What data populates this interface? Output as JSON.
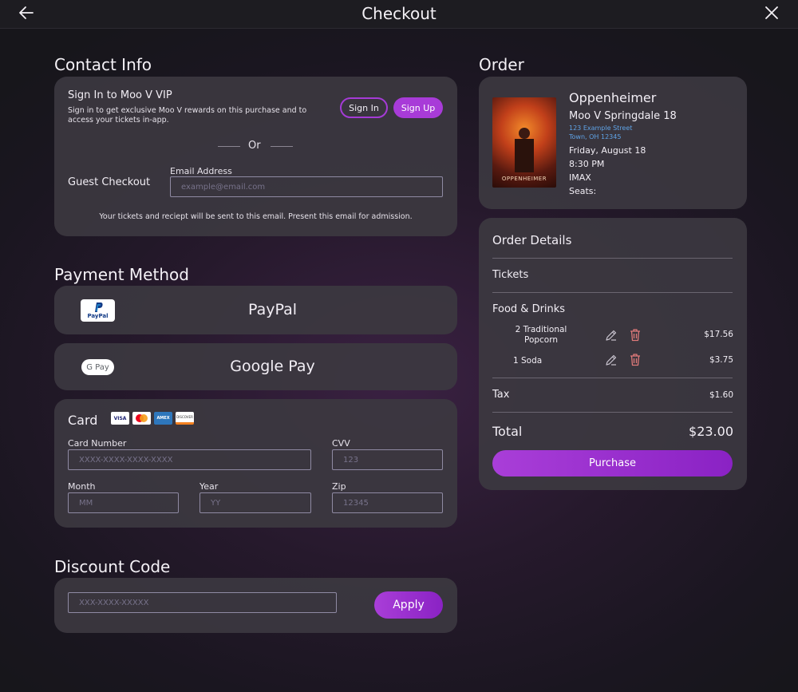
{
  "header": {
    "title": "Checkout"
  },
  "contact": {
    "section_title": "Contact Info",
    "vip_title": "Sign In to Moo V VIP",
    "vip_desc": "Sign in to get exclusive Moo V rewards on this purchase and to access your tickets in-app.",
    "signin_label": "Sign In",
    "signup_label": "Sign Up",
    "or_label": "Or",
    "guest_label": "Guest Checkout",
    "email_label": "Email Address",
    "email_placeholder": "example@email.com",
    "note": "Your tickets and reciept will be sent to this email. Present this email for admission."
  },
  "payment": {
    "section_title": "Payment Method",
    "paypal_label": "PayPal",
    "paypal_logo_text": "PayPal",
    "gpay_label": "Google Pay",
    "gpay_logo_text": "G Pay",
    "card_title": "Card",
    "card_brands": [
      "VISA",
      "MC",
      "AMEX",
      "DISCOVER"
    ],
    "card_number_label": "Card Number",
    "card_number_placeholder": "XXXX-XXXX-XXXX-XXXX",
    "cvv_label": "CVV",
    "cvv_placeholder": "123",
    "month_label": "Month",
    "month_placeholder": "MM",
    "year_label": "Year",
    "year_placeholder": "YY",
    "zip_label": "Zip",
    "zip_placeholder": "12345"
  },
  "discount": {
    "section_title": "Discount Code",
    "placeholder": "XXX-XXXX-XXXXX",
    "apply_label": "Apply"
  },
  "order": {
    "section_title": "Order",
    "movie_title": "Oppenheimer",
    "poster_text": "OPPENHEIMER",
    "theater": "Moo V Springdale 18",
    "address_line1": "123 Example Street",
    "address_line2": "Town, OH 12345",
    "date": "Friday, August 18",
    "time": "8:30 PM",
    "format": "IMAX",
    "seats_label": "Seats:"
  },
  "order_details": {
    "title": "Order Details",
    "tickets_label": "Tickets",
    "food_label": "Food & Drinks",
    "items": [
      {
        "name_line1": "2 Traditional",
        "name_line2": "Popcorn",
        "price": "$17.56"
      },
      {
        "name_line1": "1 Soda",
        "name_line2": "",
        "price": "$3.75"
      }
    ],
    "tax_label": "Tax",
    "tax_value": "$1.60",
    "total_label": "Total",
    "total_value": "$23.00",
    "purchase_label": "Purchase"
  },
  "colors": {
    "accent": "#9b2fd0",
    "accent_light": "#b13fe0",
    "address_link": "#5fa3e6",
    "delete_icon": "#e07a7a"
  }
}
